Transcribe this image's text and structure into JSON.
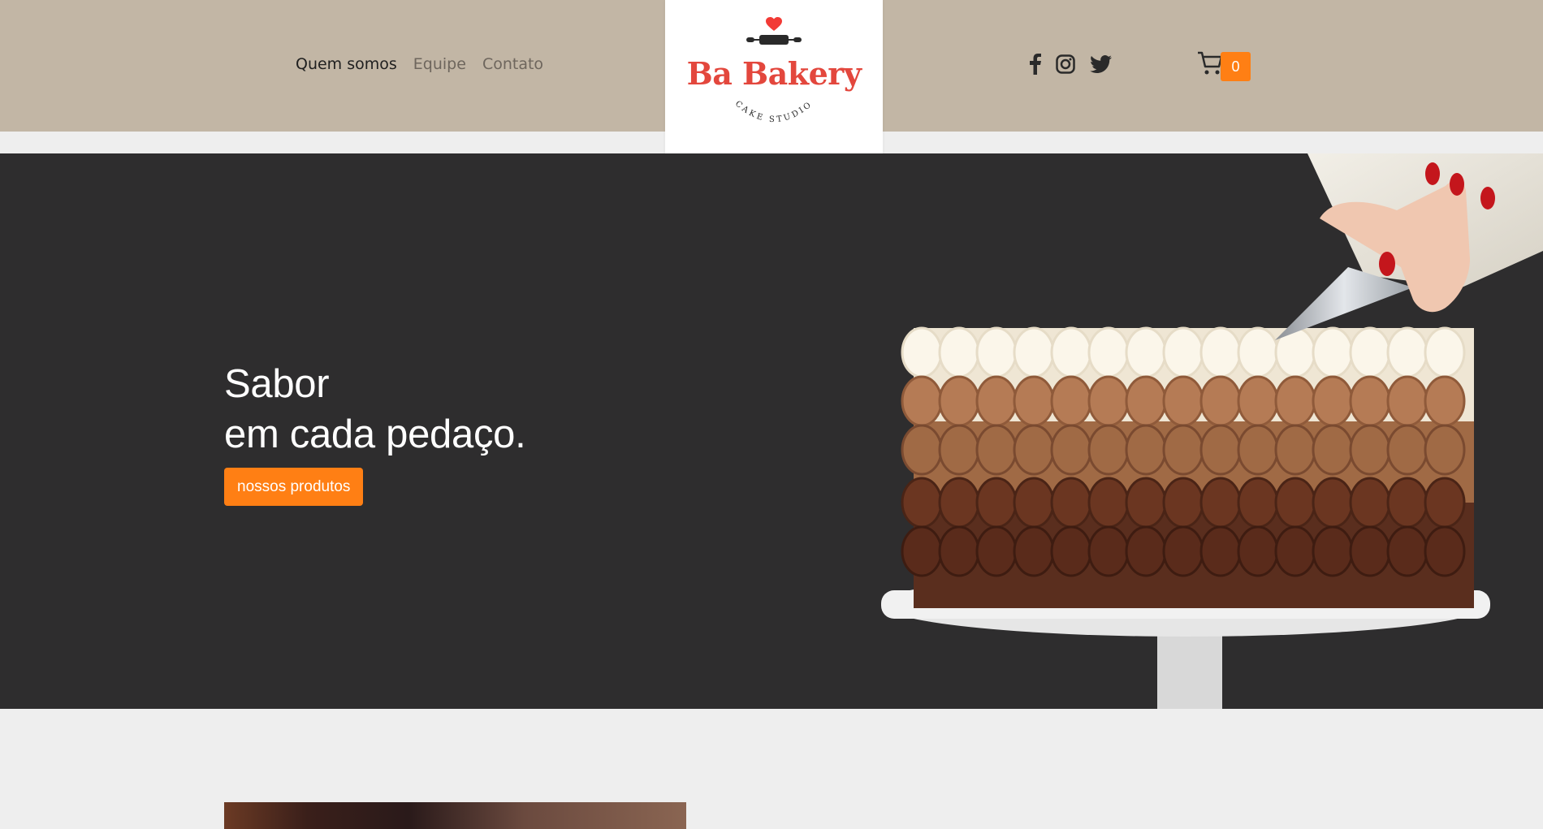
{
  "header": {
    "nav": [
      {
        "label": "Quem somos",
        "active": true
      },
      {
        "label": "Equipe",
        "active": false
      },
      {
        "label": "Contato",
        "active": false
      }
    ],
    "logo": {
      "brand": "Ba Bakery",
      "tagline": "CAKE STUDIO"
    },
    "social": [
      {
        "icon": "facebook-icon"
      },
      {
        "icon": "instagram-icon"
      },
      {
        "icon": "twitter-icon"
      }
    ],
    "cart": {
      "icon": "cart-icon",
      "count": "0"
    }
  },
  "hero": {
    "title_line1": "Sabor",
    "title_line2": "em cada pedaço.",
    "cta_label": "nossos produtos"
  },
  "colors": {
    "header_bg": "#c2b6a5",
    "accent": "#ff7f14",
    "brand_red": "#e3473d",
    "hero_bg": "#2e2d2e",
    "page_bg": "#eeeeee"
  }
}
